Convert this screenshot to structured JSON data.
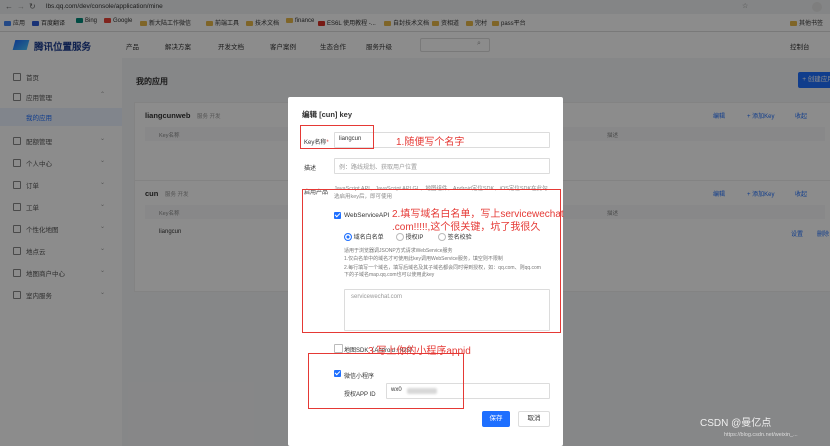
{
  "browser": {
    "url": "lbs.qq.com/dev/console/application/mine",
    "bookmarks": [
      "应用",
      "百度翻译",
      "Bing",
      "Google",
      "新大陆工作微信",
      "前端工具",
      "技术文档",
      "finance",
      "ES6L 使用教程 -...",
      "自封技术文档",
      "资相道",
      "完村",
      "pass平台"
    ],
    "right_bookmark": "其他书签"
  },
  "topnav": {
    "brand": "腾讯位置服务",
    "items": [
      "产品",
      "解决方案",
      "开发文档",
      "客户案例",
      "生态合作",
      "服务升级"
    ],
    "console": "控制台"
  },
  "sidebar": {
    "items": [
      {
        "label": "首页",
        "has_chevron": false
      },
      {
        "label": "应用管理",
        "has_chevron": true
      },
      {
        "label": "我的应用",
        "has_chevron": false,
        "active": true
      },
      {
        "label": "配额管理",
        "has_chevron": true
      },
      {
        "label": "个人中心",
        "has_chevron": true
      },
      {
        "label": "订单",
        "has_chevron": true
      },
      {
        "label": "工单",
        "has_chevron": true
      },
      {
        "label": "个性化地图",
        "has_chevron": true
      },
      {
        "label": "地点云",
        "has_chevron": true
      },
      {
        "label": "地图商户中心",
        "has_chevron": true
      },
      {
        "label": "室内服务",
        "has_chevron": true
      }
    ]
  },
  "main": {
    "title": "我的应用",
    "create_button": "+ 创建应用",
    "apps": [
      {
        "name": "liangcunweb",
        "tag": "服务 开发",
        "header_col": "Key名称",
        "desc_col": "描述",
        "actions": [
          "编辑",
          "+ 添加Key",
          "收起"
        ]
      },
      {
        "name": "cun",
        "tag": "服务 开发",
        "header_col": "Key名称",
        "desc_col": "描述",
        "row_name": "liangcun",
        "actions": [
          "编辑",
          "+ 添加Key",
          "收起"
        ],
        "row_actions": [
          "设置",
          "删除"
        ]
      }
    ]
  },
  "modal": {
    "title": "编辑 [cun] key",
    "key_name_label": "Key名称",
    "key_name_value": "liangcun",
    "desc_label": "描述",
    "desc_placeholder": "例：路线规划、获取用户位置",
    "product_label": "启用产品",
    "product_desc": "JavaScript API、JavaScript API GL、地图组件、Android定位SDK、iOS定位SDK在此勾选启用key后，即可使用",
    "webservice_label": "WebServiceAPI",
    "radio_options": [
      "域名白名单",
      "授权IP",
      "签名校验"
    ],
    "webservice_note_title": "适用于浏览器调JSONP方式请求WebService服务",
    "webservice_note_1": "1.仅白名单中的域名才可使用此key调用WebService服务，填空则不限制",
    "webservice_note_2": "2.每行填写一个域名，填写后域名及其子域名都会同时得到授权，如：qq.com、则qq.com下的子域名map.qq.com也可以使用此key",
    "domain_placeholder": "servicewechat.com",
    "sdk_label": "地图SDK（Android / iOS）",
    "miniprogram_label": "微信小程序",
    "appid_label": "授权APP ID",
    "appid_value": "wx0",
    "save_button": "保存",
    "cancel_button": "取消"
  },
  "annotations": {
    "note1": "1.随便写个名字",
    "note2_line1": "2.填写域名白名单，写上servicewechat",
    "note2_line2": ".com!!!!!,这个很关键，坑了我很久",
    "note3": "3.写上你的小程序appid"
  },
  "watermark": {
    "main": "CSDN @曼亿点",
    "url": "https://blog.csdn.net/weixin_..."
  }
}
